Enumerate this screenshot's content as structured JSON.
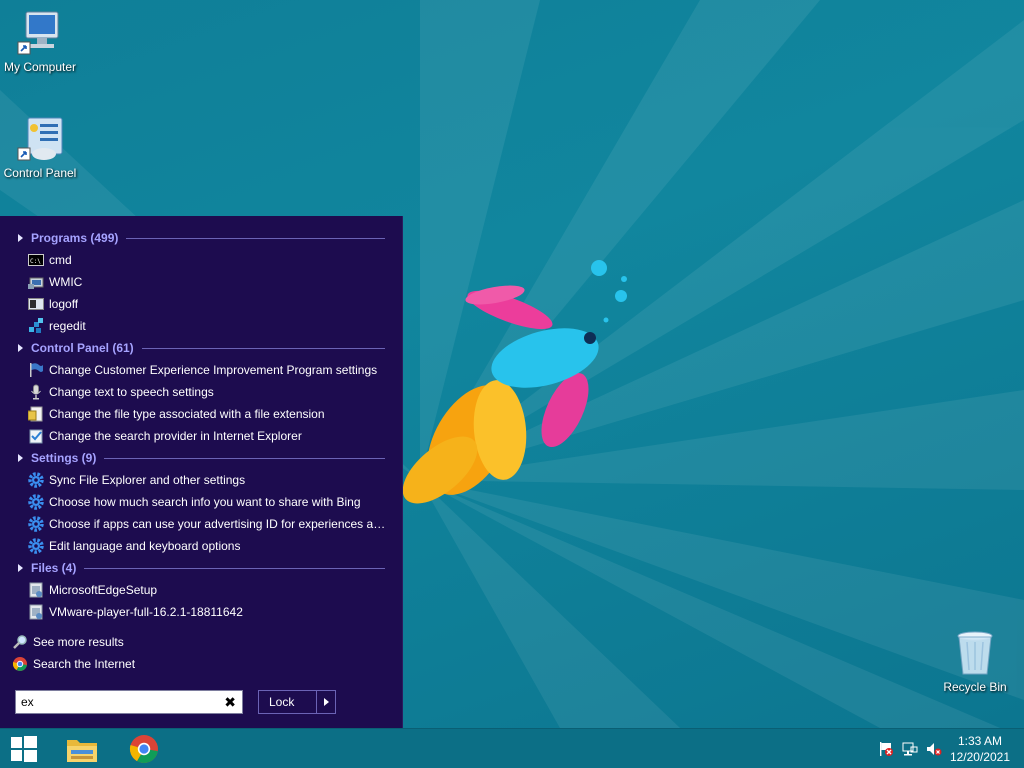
{
  "desktop": {
    "icons": [
      {
        "label": "My Computer"
      },
      {
        "label": "Control Panel"
      },
      {
        "label": "Recycle Bin"
      }
    ]
  },
  "start_menu": {
    "groups": [
      {
        "title": "Programs (499)",
        "items": [
          {
            "label": "cmd",
            "icon": "cmd-icon"
          },
          {
            "label": "WMIC",
            "icon": "wmic-icon"
          },
          {
            "label": "logoff",
            "icon": "logoff-icon"
          },
          {
            "label": "regedit",
            "icon": "regedit-icon"
          }
        ]
      },
      {
        "title": "Control Panel (61)",
        "items": [
          {
            "label": "Change Customer Experience Improvement Program settings",
            "icon": "flag-icon"
          },
          {
            "label": "Change text to speech settings",
            "icon": "microphone-icon"
          },
          {
            "label": "Change the file type associated with a file extension",
            "icon": "file-type-icon"
          },
          {
            "label": "Change the search provider in Internet Explorer",
            "icon": "checklist-icon"
          }
        ]
      },
      {
        "title": "Settings (9)",
        "items": [
          {
            "label": "Sync File Explorer and other settings",
            "icon": "gear-icon"
          },
          {
            "label": "Choose how much search info you want to share with Bing",
            "icon": "gear-icon"
          },
          {
            "label": "Choose if apps can use your advertising ID for experiences acr...",
            "icon": "gear-icon"
          },
          {
            "label": "Edit language and keyboard options",
            "icon": "gear-icon"
          }
        ]
      },
      {
        "title": "Files (4)",
        "items": [
          {
            "label": "MicrosoftEdgeSetup",
            "icon": "installer-icon"
          },
          {
            "label": "VMware-player-full-16.2.1-18811642",
            "icon": "installer-icon"
          }
        ]
      }
    ],
    "see_more": "See more results",
    "search_internet": "Search the Internet",
    "search_value": "ex",
    "lock_label": "Lock"
  },
  "taskbar": {
    "time": "1:33 AM",
    "date": "12/20/2021"
  },
  "colors": {
    "menu_bg": "#1d0c4f",
    "group_header": "#a6a3ff",
    "desktop_bg": "#0f7f98",
    "taskbar_bg": "#0c6f86"
  }
}
